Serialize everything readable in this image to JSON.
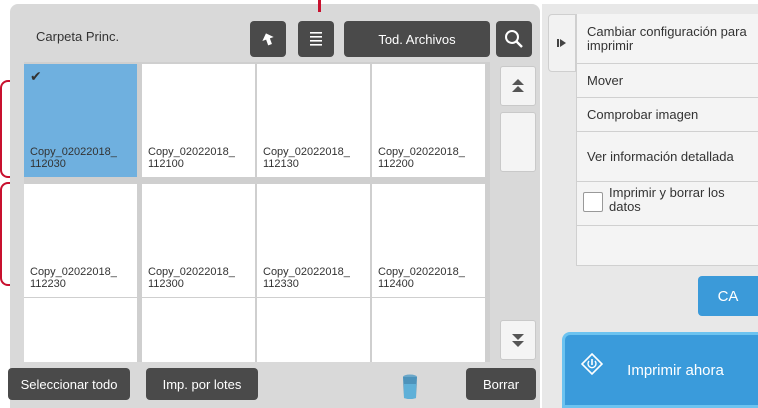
{
  "header": {
    "folder_name": "Carpeta Princ.",
    "all_files_label": "Tod. Archivos"
  },
  "files": [
    {
      "name": "Copy_02022018_\n112030",
      "selected": true
    },
    {
      "name": "Copy_02022018_\n112100",
      "selected": false
    },
    {
      "name": "Copy_02022018_\n112130",
      "selected": false
    },
    {
      "name": "Copy_02022018_\n112200",
      "selected": false
    },
    {
      "name": "Copy_02022018_\n112230",
      "selected": false
    },
    {
      "name": "Copy_02022018_\n112300",
      "selected": false
    },
    {
      "name": "Copy_02022018_\n112330",
      "selected": false
    },
    {
      "name": "Copy_02022018_\n112400",
      "selected": false
    },
    {
      "name": "",
      "selected": false
    },
    {
      "name": "",
      "selected": false
    },
    {
      "name": "",
      "selected": false
    },
    {
      "name": "",
      "selected": false
    }
  ],
  "bottom": {
    "select_all_label": "Seleccionar todo",
    "batch_print_label": "Imp. por lotes",
    "delete_label": "Borrar"
  },
  "side_menu": {
    "items": [
      {
        "label": "Cambiar configuración para imprimir",
        "checkbox": false
      },
      {
        "label": "Mover",
        "checkbox": false
      },
      {
        "label": "Comprobar imagen",
        "checkbox": false
      },
      {
        "label": "Ver información detallada",
        "checkbox": false
      },
      {
        "label": "Imprimir y borrar los datos",
        "checkbox": true
      }
    ],
    "ca_label": "CA",
    "print_now_label": "Imprimir ahora"
  },
  "colors": {
    "accent": "#3a9bdb",
    "selected_tile": "#6fb0df",
    "dark_button": "#4a4a4a",
    "callout": "#c8102e"
  }
}
